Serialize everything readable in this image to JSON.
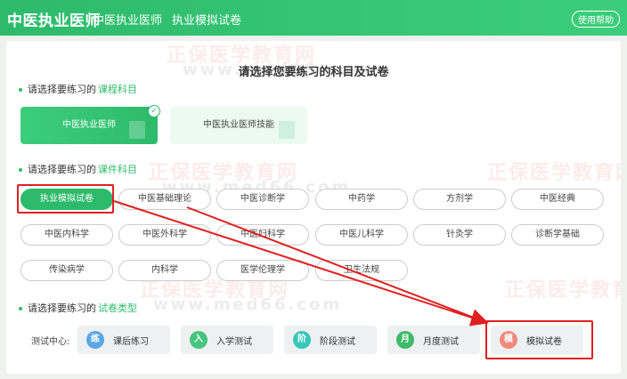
{
  "header": {
    "brand": "中医执业医师",
    "crumb1": "中医执业医师",
    "crumb2": "执业模拟试卷",
    "help": "使用帮助"
  },
  "watermark": {
    "logo": "正保",
    "text": "医学教育网",
    "site": "www.med66.com"
  },
  "main_title": "请选择您要练习的科目及试卷",
  "sections": {
    "course": {
      "prefix": "请选择要练习的",
      "highlight": "课程科目"
    },
    "subject": {
      "prefix": "请选择要练习的",
      "highlight": "课件科目"
    },
    "paper": {
      "prefix": "请选择要练习的",
      "highlight": "试卷类型"
    }
  },
  "courses": [
    "中医执业医师",
    "中医执业医师技能"
  ],
  "check_mark": "✓",
  "subjects": [
    "执业模拟试卷",
    "中医基础理论",
    "中医诊断学",
    "中药学",
    "方剂学",
    "中医经典",
    "中医内科学",
    "中医外科学",
    "中医妇科学",
    "中医儿科学",
    "针灸学",
    "诊断学基础",
    "传染病学",
    "内科学",
    "医学伦理学",
    "卫生法规"
  ],
  "test_center": {
    "label": "测试中心:",
    "items": [
      {
        "icon": "练",
        "label": "课后练习",
        "color": "#5ba7e6"
      },
      {
        "icon": "入",
        "label": "入学测试",
        "color": "#46c57f"
      },
      {
        "icon": "阶",
        "label": "阶段测试",
        "color": "#35c7b9"
      },
      {
        "icon": "月",
        "label": "月度测试",
        "color": "#3dba6a"
      },
      {
        "icon": "模",
        "label": "模拟试卷",
        "color": "#f08a7e"
      }
    ]
  },
  "colors": {
    "accent": "#2dbb6b",
    "annotation": "#e02020"
  }
}
